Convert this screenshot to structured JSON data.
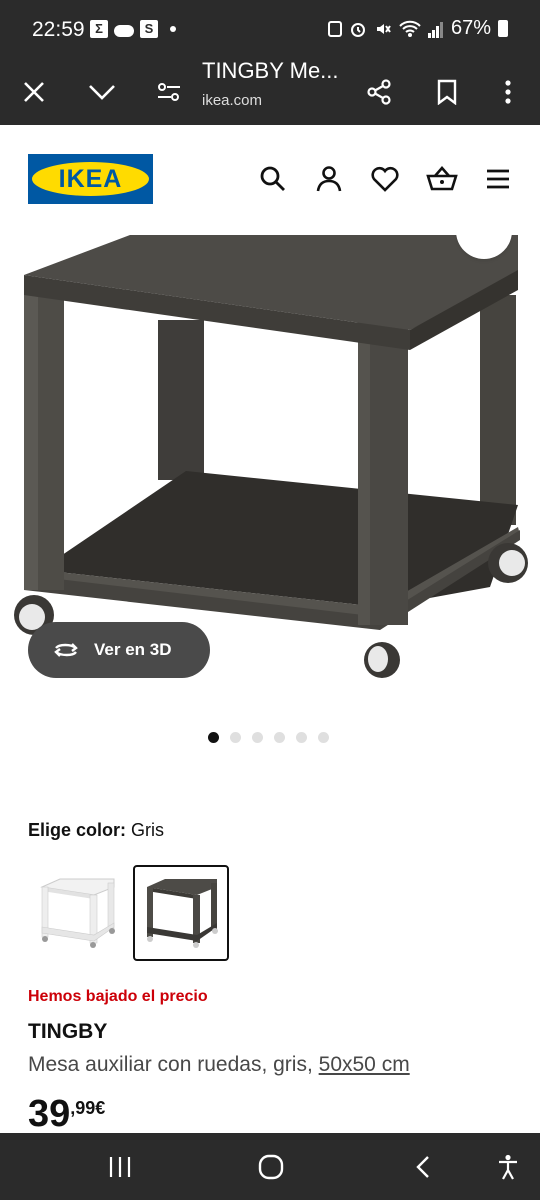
{
  "status_bar": {
    "time": "22:59",
    "icons_left": [
      "sigma-icon",
      "cloud-icon",
      "s-app-icon",
      "dot-icon"
    ],
    "sigma": "Σ",
    "s_app": "S",
    "battery": "67%"
  },
  "browser": {
    "page_title": "TINGBY Me...",
    "domain": "ikea.com"
  },
  "header": {
    "logo_text": "IKEA"
  },
  "gallery": {
    "view_3d_label": "Ver en 3D",
    "dots_count": 6,
    "active_dot": 0
  },
  "color": {
    "label": "Elige color:",
    "value": "Gris",
    "options": [
      "white",
      "gray"
    ],
    "selected": "gray"
  },
  "product": {
    "price_note": "Hemos bajado el precio",
    "name": "TINGBY",
    "description": "Mesa auxiliar con ruedas, gris,",
    "size": "50x50 cm",
    "price_integer": "39",
    "price_decimal": ",99€"
  },
  "colors": {
    "status_bg": "#2b2b2b",
    "ikea_blue": "#0058a3",
    "ikea_yellow": "#ffdb00",
    "price_red": "#cc0008",
    "table_gray": "#4d4b47"
  }
}
